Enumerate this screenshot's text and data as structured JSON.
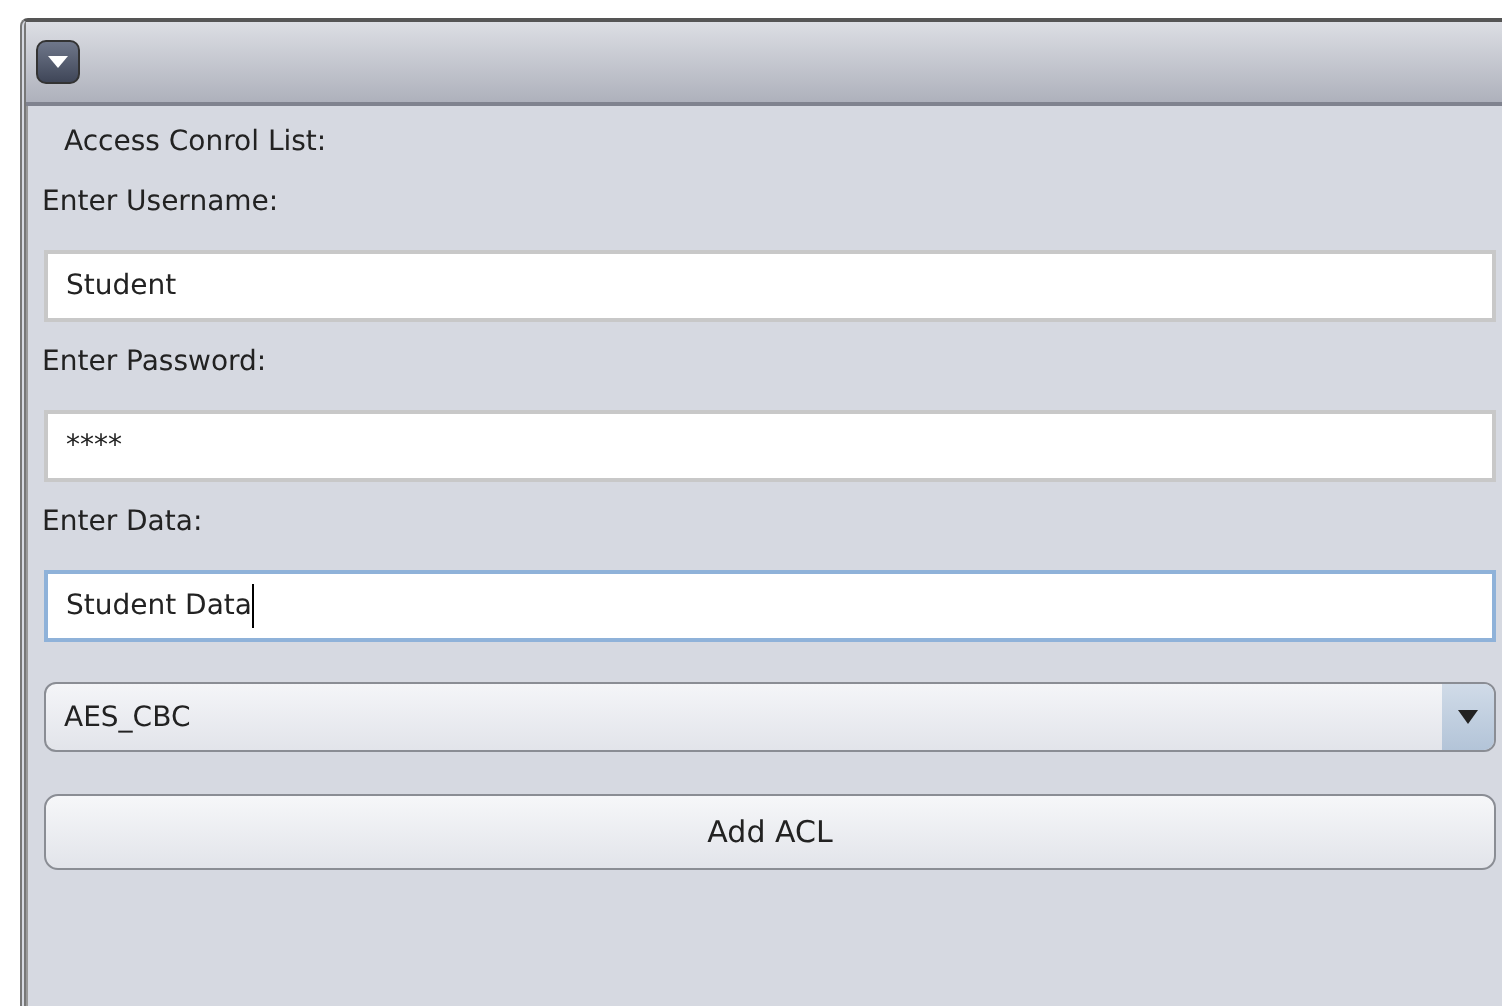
{
  "panel": {
    "collapsed": false
  },
  "heading": "Access Conrol List:",
  "fields": [
    {
      "label": "Enter Username:",
      "value": "Student",
      "focused": false
    },
    {
      "label": "Enter Password:",
      "value": "****",
      "focused": false
    },
    {
      "label": "Enter Data:",
      "value": "Student Data",
      "focused": true
    }
  ],
  "dropdown": {
    "value": "AES_CBC"
  },
  "buttons": [
    "Add ACL"
  ]
}
